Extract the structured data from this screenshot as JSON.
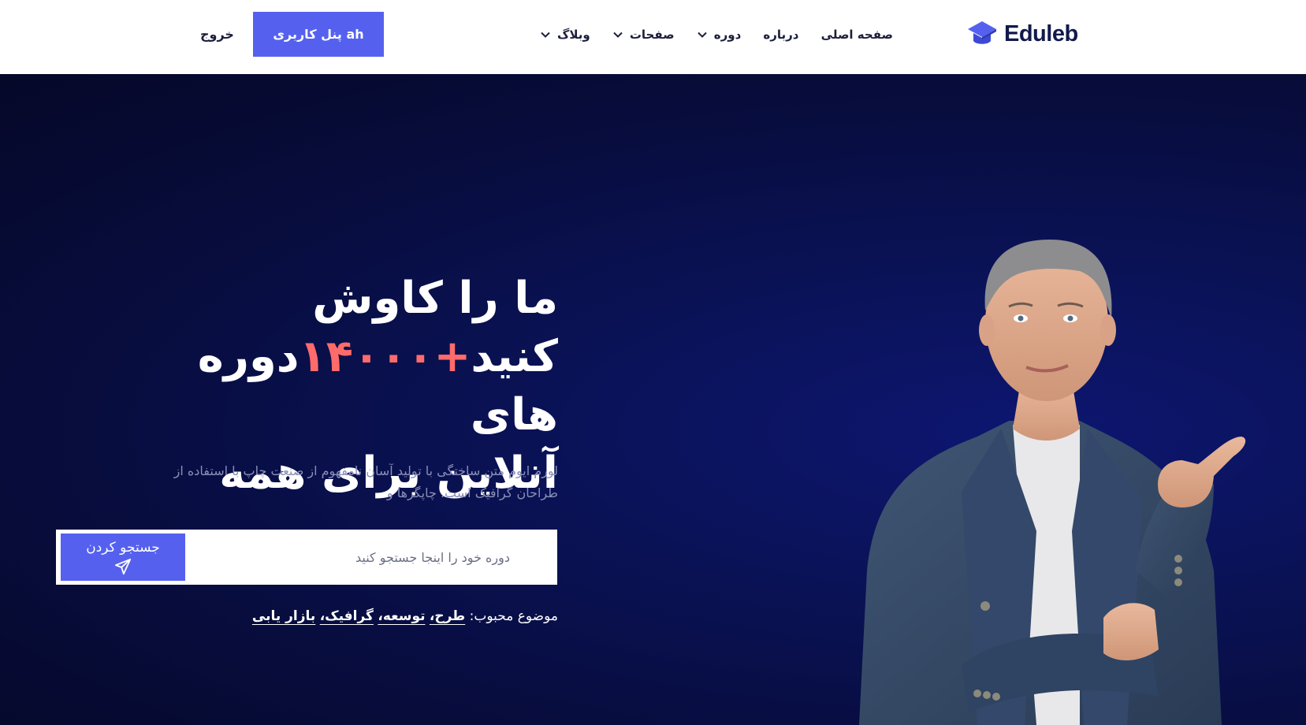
{
  "header": {
    "logo_text": "Eduleb",
    "logo_icon": "graduation-cap-icon",
    "nav": [
      {
        "label": "صفحه اصلی",
        "dropdown": false
      },
      {
        "label": "درباره",
        "dropdown": false
      },
      {
        "label": "دوره",
        "dropdown": true
      },
      {
        "label": "صفحات",
        "dropdown": true
      },
      {
        "label": "وبلاگ",
        "dropdown": true
      }
    ],
    "panel_button": "پنل کاربری ah",
    "logout": "خروج"
  },
  "hero": {
    "headline_line1": "ما را کاوش",
    "headline_line2_a": "کنید",
    "headline_accent": "+۱۴۰۰۰",
    "headline_line2_b": "دوره های",
    "headline_line3": "آنلاین برای همه",
    "description": "لورم ایوم متن ساختگی با تولید آسان نامفهوم از صنعت چاپ با استفاده از طراحان گرافیک است. چاپگرها و",
    "search": {
      "placeholder": "دوره خود را اینجا جستجو کنید",
      "button_label": "جستجو کردن",
      "button_icon": "paper-plane-icon"
    },
    "topics_label": "موضوع محبوب:",
    "topics": [
      "طرح،",
      "توسعه،",
      "گرافیک،",
      "بازار یابی"
    ]
  },
  "colors": {
    "accent": "#5561ee",
    "highlight": "#ff6b6b",
    "hero_bg": "#070c3a",
    "nav_text": "#1b1f3b"
  }
}
